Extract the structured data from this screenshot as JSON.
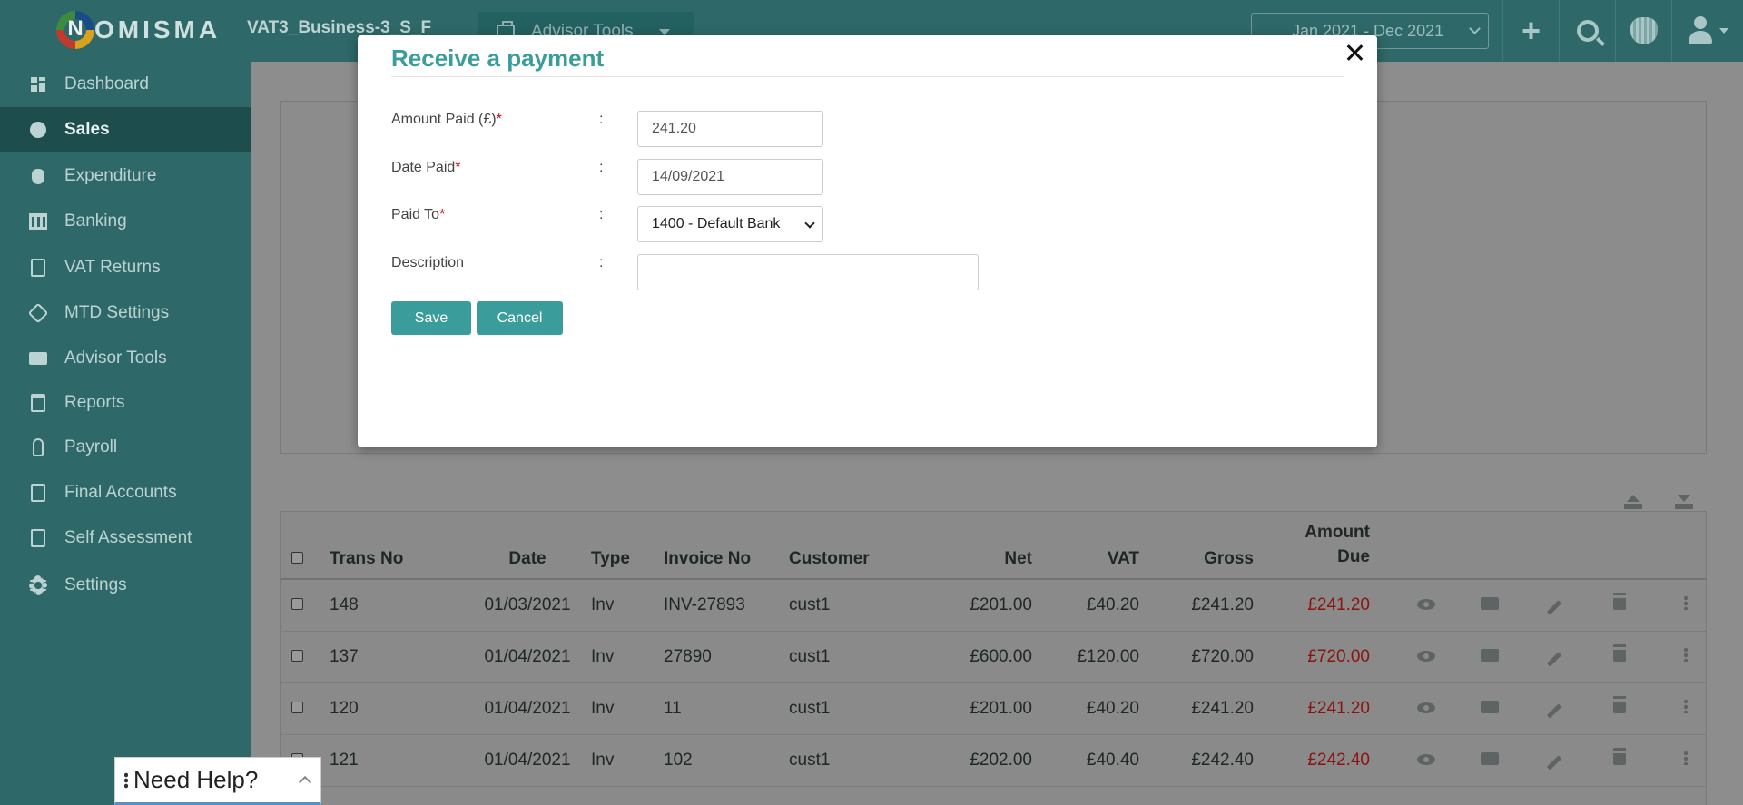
{
  "header": {
    "logo_letter": "N",
    "logo_text": "OMISMA",
    "business_name": "VAT3_Business-3_S_F",
    "advisor_tools_label": "Advisor Tools",
    "period": "Jan 2021 - Dec 2021"
  },
  "sidebar": {
    "items": [
      {
        "label": "Dashboard",
        "icon": "dashboard-icon"
      },
      {
        "label": "Sales",
        "icon": "sales-icon"
      },
      {
        "label": "Expenditure",
        "icon": "expenditure-icon"
      },
      {
        "label": "Banking",
        "icon": "bank-icon"
      },
      {
        "label": "VAT Returns",
        "icon": "vat-returns-icon"
      },
      {
        "label": "MTD Settings",
        "icon": "mtd-settings-icon"
      },
      {
        "label": "Advisor Tools",
        "icon": "briefcase-icon"
      },
      {
        "label": "Reports",
        "icon": "reports-icon"
      },
      {
        "label": "Payroll",
        "icon": "payroll-icon"
      },
      {
        "label": "Final Accounts",
        "icon": "final-accounts-icon"
      },
      {
        "label": "Self Assessment",
        "icon": "self-assessment-icon"
      },
      {
        "label": "Settings",
        "icon": "gear-icon"
      }
    ],
    "active": "Sales"
  },
  "table": {
    "headers": {
      "trans_no": "Trans No",
      "date": "Date",
      "type": "Type",
      "invoice_no": "Invoice No",
      "customer": "Customer",
      "net": "Net",
      "vat": "VAT",
      "gross": "Gross",
      "amount_due_1": "Amount",
      "amount_due_2": "Due"
    },
    "rows": [
      {
        "trans_no": "148",
        "date": "01/03/2021",
        "type": "Inv",
        "invoice_no": "INV-27893",
        "customer": "cust1",
        "net": "£201.00",
        "vat": "£40.20",
        "gross": "£241.20",
        "due": "£241.20"
      },
      {
        "trans_no": "137",
        "date": "01/04/2021",
        "type": "Inv",
        "invoice_no": "27890",
        "customer": "cust1",
        "net": "£600.00",
        "vat": "£120.00",
        "gross": "£720.00",
        "due": "£720.00"
      },
      {
        "trans_no": "120",
        "date": "01/04/2021",
        "type": "Inv",
        "invoice_no": "11",
        "customer": "cust1",
        "net": "£201.00",
        "vat": "£40.20",
        "gross": "£241.20",
        "due": "£241.20"
      },
      {
        "trans_no": "121",
        "date": "01/04/2021",
        "type": "Inv",
        "invoice_no": "102",
        "customer": "cust1",
        "net": "£202.00",
        "vat": "£40.40",
        "gross": "£242.40",
        "due": "£242.40"
      }
    ]
  },
  "help": {
    "label": "Need Help?"
  },
  "modal": {
    "title": "Receive a payment",
    "colon": ":",
    "required_mark": "*",
    "fields": {
      "amount_label": "Amount Paid (£)",
      "amount_value": "241.20",
      "date_label": "Date Paid",
      "date_value": "14/09/2021",
      "paid_to_label": "Paid To",
      "paid_to_value": "1400 - Default Bank",
      "description_label": "Description",
      "description_value": ""
    },
    "save_label": "Save",
    "cancel_label": "Cancel"
  },
  "colors": {
    "sidebar_bg": "#2f6868",
    "accent": "#3a9d9b",
    "due_text": "#8b1410"
  }
}
